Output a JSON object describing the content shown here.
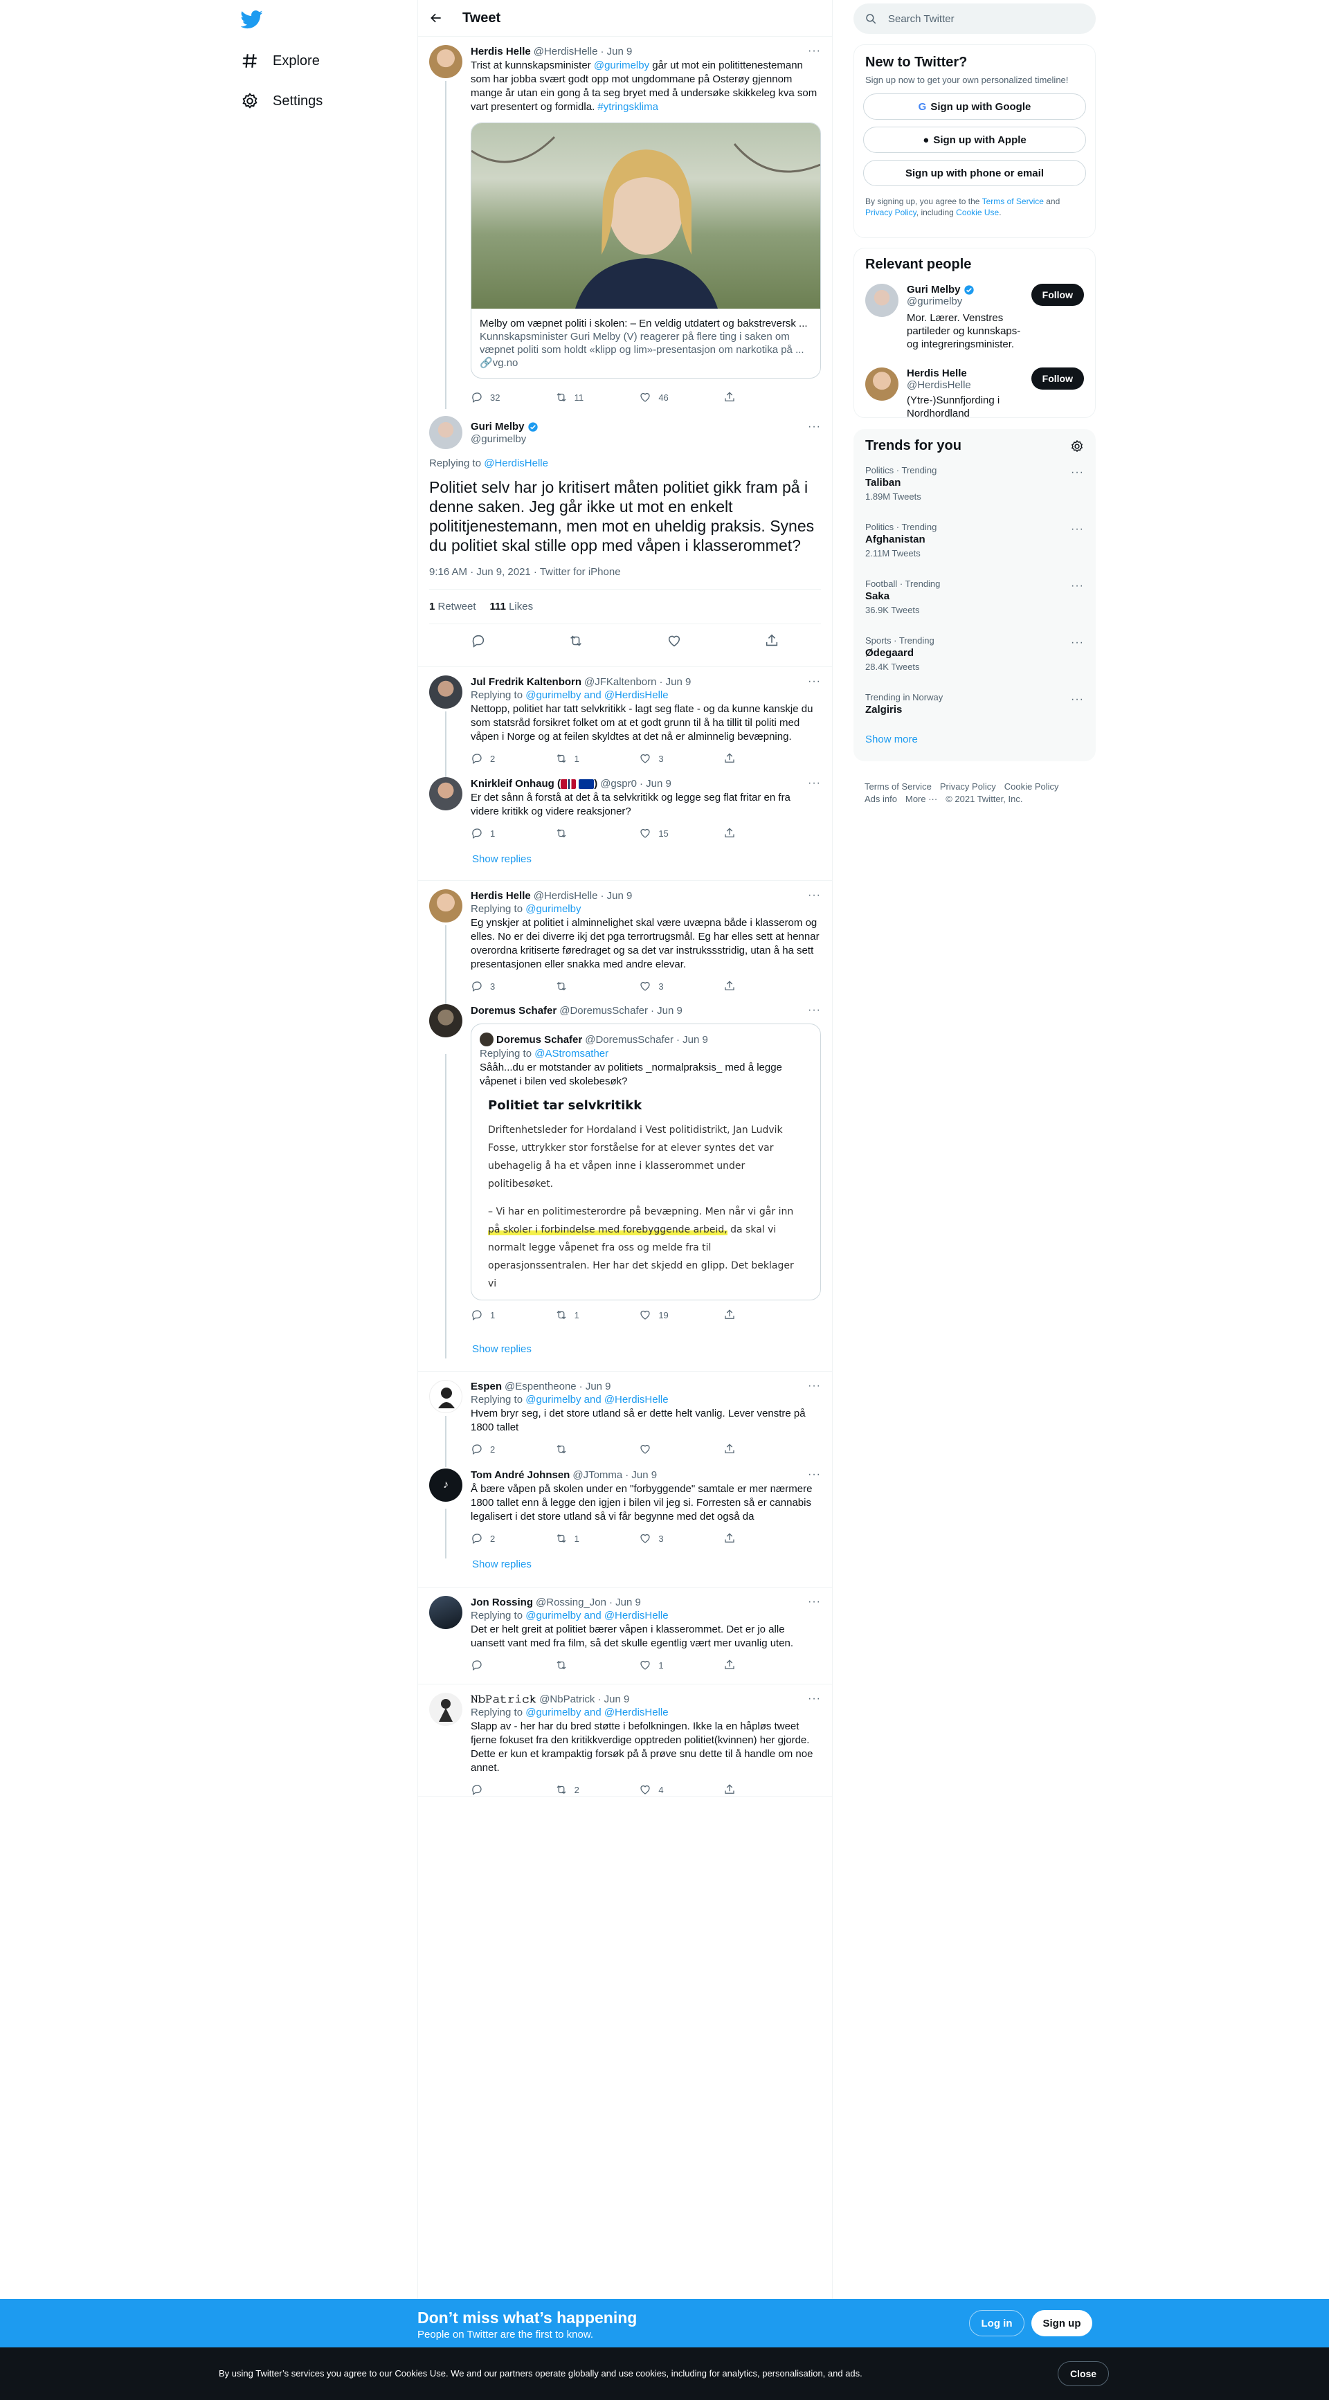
{
  "nav": {
    "explore": "Explore",
    "settings": "Settings"
  },
  "header": {
    "title": "Tweet"
  },
  "tweets": {
    "t1": {
      "name": "Herdis Helle",
      "handle": "@HerdisHelle",
      "date": "· Jun 9",
      "text_pre": "Trist at kunnskapsminister ",
      "mention": "@gurimelby",
      "text_post": " går ut mot ein politittenestemann som har jobba svært godt opp mot ungdommane på Osterøy gjennom mange år utan ein gong å ta seg bryet med å undersøke skikkeleg kva som vart presentert og formidla. ",
      "hashtag": "#ytringsklima",
      "card_title": "Melby om væpnet politi i skolen: – En veldig utdatert og bakstreversk ...",
      "card_desc": "Kunnskapsminister Guri Melby (V) reagerer på flere ting i saken om væpnet politi som holdt «klipp og lim»-presentasjon om narkotika på ...",
      "card_domain": "vg.no",
      "replies": "32",
      "retweets": "11",
      "likes": "46"
    },
    "focus": {
      "name": "Guri Melby",
      "handle": "@gurimelby",
      "replying_label": "Replying to ",
      "replying_to": "@HerdisHelle",
      "text": "Politiet selv har jo kritisert måten politiet gikk fram på i denne saken. Jeg går ikke ut mot en enkelt polititjenestemann, men mot en uheldig praksis. Synes du politiet skal stille opp med våpen i klasserommet?",
      "stamp": "9:16 AM · Jun 9, 2021 · Twitter for iPhone",
      "retweets_count": "1",
      "retweets_label": " Retweet",
      "likes_count": "111",
      "likes_label": " Likes"
    },
    "r1": {
      "name": "Jul Fredrik Kaltenborn",
      "handle": "@JFKaltenborn",
      "date": "· Jun 9",
      "replying_label": "Replying to ",
      "replying_to": "@gurimelby and @HerdisHelle",
      "text": "Nettopp, politiet har tatt selvkritikk - lagt seg flate - og da kunne kanskje du som statsråd forsikret folket om at et godt grunn til å ha tillit til politi med våpen i Norge og at feilen skyldtes at det nå er alminnelig bevæpning.",
      "replies": "2",
      "retweets": "1",
      "likes": "3"
    },
    "r2": {
      "name": "Knirkleif Onhaug (",
      "name_end": ")",
      "handle": "@gspr0",
      "date": "· Jun 9",
      "text": "Er det sånn å forstå at det å ta selvkritikk og legge seg flat fritar en fra videre kritikk og videre reaksjoner?",
      "replies": "1",
      "retweets": "",
      "likes": "15",
      "show_replies": "Show replies"
    },
    "r3": {
      "name": "Herdis Helle",
      "handle": "@HerdisHelle",
      "date": "· Jun 9",
      "replying_label": "Replying to ",
      "replying_to": "@gurimelby",
      "text": "Eg ynskjer at politiet i alminnelighet skal være uvæpna både i klasserom og elles. No er dei diverre ikj det pga terrortrugsmål. Eg har elles sett at hennar overordna kritiserte føredraget og sa det var instrukssstridig, utan å ha sett presentasjonen eller snakka med andre elevar.",
      "replies": "3",
      "retweets": "",
      "likes": "3"
    },
    "r4": {
      "name": "Doremus Schafer",
      "handle": "@DoremusSchafer",
      "date": "· Jun 9",
      "q_name": "Doremus Schafer",
      "q_handle": "@DoremusSchafer",
      "q_date": "· Jun 9",
      "q_replying_label": "Replying to ",
      "q_replying_to": "@AStromsather",
      "q_text": "Sååh...du er motstander av politiets _normalpraksis_ med å legge våpenet i bilen ved skolebesøk?",
      "article_title": "Politiet tar selvkritikk",
      "article_p1": "Driftenhetsleder for Hordaland i Vest politidistrikt, Jan Ludvik Fosse, uttrykker stor forståelse for at elever syntes det var ubehagelig å ha et våpen inne i klasserommet under politibesøket.",
      "article_p2_pre": "– Vi har en politimesterordre på bevæpning. Men når vi går inn ",
      "article_p2_hl": "på skoler i forbindelse med forebyggende arbeid,",
      "article_p2_post": " da skal vi normalt legge våpenet fra oss og melde fra til operasjonssentralen. Her har det skjedd en glipp. Det beklager vi",
      "replies": "1",
      "retweets": "1",
      "likes": "19",
      "show_replies": "Show replies"
    },
    "r5": {
      "name": "Espen",
      "handle": "@Espentheone",
      "date": "· Jun 9",
      "replying_label": "Replying to ",
      "replying_to": "@gurimelby and @HerdisHelle",
      "text": "Hvem bryr seg, i det store utland så er dette helt vanlig. Lever venstre på 1800 tallet",
      "replies": "2",
      "retweets": "",
      "likes": ""
    },
    "r6": {
      "name": "Tom André Johnsen",
      "handle": "@JTomma",
      "date": "· Jun 9",
      "text": "Å bære våpen på skolen under en \"forbyggende\" samtale er mer nærmere 1800 tallet enn å legge den igjen i bilen vil jeg si. Forresten så er cannabis legalisert i det store utland så vi får begynne med det også da",
      "replies": "2",
      "retweets": "1",
      "likes": "3",
      "show_replies": "Show replies"
    },
    "r7": {
      "name": "Jon Rossing",
      "handle": "@Rossing_Jon",
      "date": "· Jun 9",
      "replying_label": "Replying to ",
      "replying_to": "@gurimelby and @HerdisHelle",
      "text": "Det er helt greit at politiet bærer våpen i klasserommet. Det er jo alle uansett vant med fra film, så det skulle egentlig vært mer uvanlig uten.",
      "replies": "",
      "retweets": "",
      "likes": "1"
    },
    "r8": {
      "name": "𝙽𝚋𝙿𝚊𝚝𝚛𝚒𝚌𝚔",
      "handle": "@NbPatrick",
      "date": "· Jun 9",
      "replying_label": "Replying to ",
      "replying_to": "@gurimelby and @HerdisHelle",
      "text": "Slapp av - her har du bred støtte i befolkningen. Ikke la en håpløs tweet fjerne fokuset fra den kritikkverdige opptreden politiet(kvinnen) her gjorde. Dette er kun et krampaktig forsøk på å prøve snu dette til å handle om noe annet.",
      "replies": "",
      "retweets": "2",
      "likes": "4"
    }
  },
  "sidebar": {
    "search_placeholder": "Search Twitter",
    "new_title": "New to Twitter?",
    "new_sub": "Sign up now to get your own personalized timeline!",
    "google": "Sign up with Google",
    "apple": "Sign up with Apple",
    "phone": "Sign up with phone or email",
    "terms_1": "By signing up, you agree to the ",
    "terms_link1": "Terms of Service",
    "terms_2": " and ",
    "terms_link2": "Privacy Policy",
    "terms_3": ", including ",
    "terms_link3": "Cookie Use",
    "terms_4": ".",
    "relevant_title": "Relevant people",
    "p1_name": "Guri Melby",
    "p1_handle": "@gurimelby",
    "p1_bio": "Mor. Lærer. Venstres partileder og kunnskaps- og integreringsminister.",
    "p2_name": "Herdis Helle",
    "p2_handle": "@HerdisHelle",
    "p2_bio": "(Ytre-)Sunnfjording i Nordhordland",
    "follow": "Follow",
    "trends_title": "Trends for you",
    "trends": [
      {
        "cat": "Politics · Trending",
        "name": "Taliban",
        "count": "1.89M Tweets"
      },
      {
        "cat": "Politics · Trending",
        "name": "Afghanistan",
        "count": "2.11M Tweets"
      },
      {
        "cat": "Football · Trending",
        "name": "Saka",
        "count": "36.9K Tweets"
      },
      {
        "cat": "Sports · Trending",
        "name": "Ødegaard",
        "count": "28.4K Tweets"
      },
      {
        "cat": "Trending in Norway",
        "name": "Zalgiris",
        "count": ""
      }
    ],
    "show_more": "Show more",
    "footer": [
      "Terms of Service",
      "Privacy Policy",
      "Cookie Policy",
      "Ads info",
      "More ···",
      "© 2021 Twitter, Inc."
    ]
  },
  "bottom": {
    "headline": "Don’t miss what’s happening",
    "sub": "People on Twitter are the first to know.",
    "login": "Log in",
    "signup": "Sign up",
    "cookie_text": "By using Twitter’s services you agree to our Cookies Use. We and our partners operate globally and use cookies, including for analytics, personalisation, and ads.",
    "close": "Close"
  },
  "colors": {
    "accent": "#1d9bf0",
    "text": "#0f1419",
    "muted": "#536471"
  }
}
